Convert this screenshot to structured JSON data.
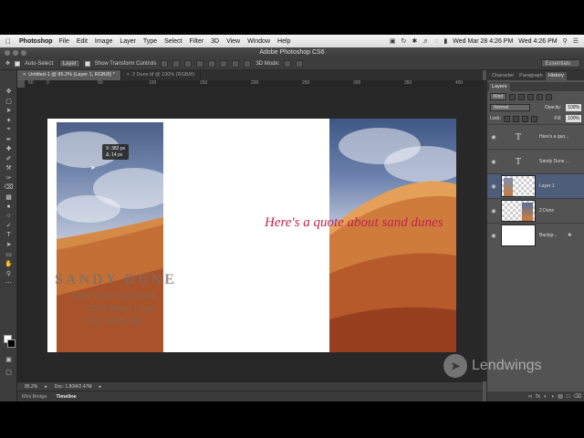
{
  "menubar": {
    "app_name": "Photoshop",
    "items": [
      "File",
      "Edit",
      "Image",
      "Layer",
      "Type",
      "Select",
      "Filter",
      "3D",
      "View",
      "Window",
      "Help"
    ],
    "clock_date": "Wed Mar 28  4:26 PM",
    "clock_short": "Wed 4:26 PM"
  },
  "window": {
    "title": "Adobe Photoshop CS6"
  },
  "options": {
    "auto_select_label": "Auto-Select:",
    "auto_select_value": "Layer",
    "show_transform_label": "Show Transform Controls",
    "mode_3d": "3D Mode:",
    "workspace": "Essentials"
  },
  "doc_tabs": [
    {
      "label": "Untitled-1 @ 85.2% (Layer 1, RGB/8) *",
      "active": true
    },
    {
      "label": "2 Dune.tif @ 100% (RGB/8)",
      "active": false
    }
  ],
  "ruler_ticks": [
    "50",
    "0",
    "50",
    "100",
    "150",
    "200",
    "250",
    "300",
    "350",
    "400"
  ],
  "hud": {
    "line1": "X: 382 px",
    "line2": "Δ: 14 px"
  },
  "canvas": {
    "business_card": {
      "name": "SANDY DUNE",
      "title": "Sand Dune Salesman",
      "address": "1234 Street Lane",
      "phone": "123-3456-345"
    },
    "quote": "Here's a quote about sand dunes"
  },
  "status": {
    "zoom": "85.2%",
    "doc_size": "Doc: 1.80M/2.47M"
  },
  "bottom_tabs": [
    {
      "label": "Mini Bridge",
      "active": false
    },
    {
      "label": "Timeline",
      "active": true
    }
  ],
  "panel": {
    "top_tabs": [
      "Character",
      "Paragraph",
      "History"
    ],
    "layers_tab": "Layers",
    "kind": "Kind",
    "blend": "Normal",
    "opacity_label": "Opacity:",
    "opacity_value": "100%",
    "lock_label": "Lock:",
    "fill_label": "Fill:",
    "fill_value": "100%",
    "layers": [
      {
        "name": "Here's a quo...",
        "type": "text",
        "selected": false
      },
      {
        "name": "Sandy Dune ...",
        "type": "text",
        "selected": false
      },
      {
        "name": "Layer 1",
        "type": "image-checker",
        "selected": true
      },
      {
        "name": "2 Dune",
        "type": "image-checker-dune",
        "selected": false
      },
      {
        "name": "Backgr...",
        "type": "white",
        "selected": false,
        "locked": true
      }
    ]
  },
  "watermark": "Lendwings"
}
